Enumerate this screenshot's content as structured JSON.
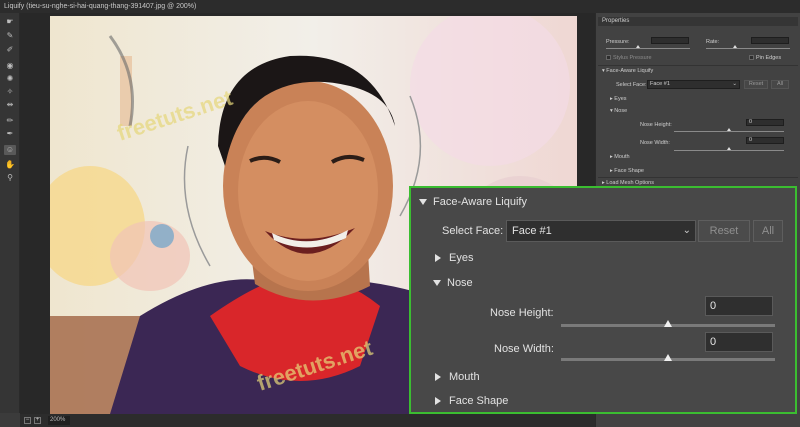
{
  "window": {
    "title": "Liquify (tieu-su-nghe-si-hai-quang-thang-391407.jpg @ 200%)"
  },
  "toolbar": {
    "tools": [
      {
        "name": "forward-warp-tool-icon",
        "glyph": "☛"
      },
      {
        "name": "reconstruct-tool-icon",
        "glyph": "✎"
      },
      {
        "name": "smooth-tool-icon",
        "glyph": "✐"
      },
      {
        "name": "twirl-tool-icon",
        "glyph": "◉"
      },
      {
        "name": "pucker-tool-icon",
        "glyph": "✺"
      },
      {
        "name": "bloat-tool-icon",
        "glyph": "✧"
      },
      {
        "name": "push-left-tool-icon",
        "glyph": "⇹"
      },
      {
        "name": "freeze-mask-tool-icon",
        "glyph": "✏"
      },
      {
        "name": "thaw-mask-tool-icon",
        "glyph": "✒"
      },
      {
        "name": "face-tool-icon",
        "glyph": "☺"
      },
      {
        "name": "hand-tool-icon",
        "glyph": "✋"
      },
      {
        "name": "zoom-tool-icon",
        "glyph": "⚲"
      }
    ]
  },
  "canvas": {
    "watermark": "freetuts.net"
  },
  "status": {
    "zoom_out": "−",
    "zoom_in": "+",
    "zoom": "200%"
  },
  "properties": {
    "title": "Properties",
    "pressure_label": "Pressure:",
    "rate_label": "Rate:",
    "stylus_pressure": "Stylus Pressure",
    "pin_edges": "Pin Edges",
    "face_aware_label": "Face-Aware Liquify",
    "select_face_label": "Select Face:",
    "select_face_value": "Face #1",
    "reset_label": "Reset",
    "all_label": "All",
    "eyes_label": "Eyes",
    "nose_label": "Nose",
    "nose_height_label": "Nose Height:",
    "nose_height_value": "0",
    "nose_width_label": "Nose Width:",
    "nose_width_value": "0",
    "mouth_label": "Mouth",
    "face_shape_label": "Face Shape",
    "load_mesh_label": "Load Mesh Options"
  },
  "colors": {
    "highlight": "#3bbd31",
    "panel": "#484848"
  }
}
